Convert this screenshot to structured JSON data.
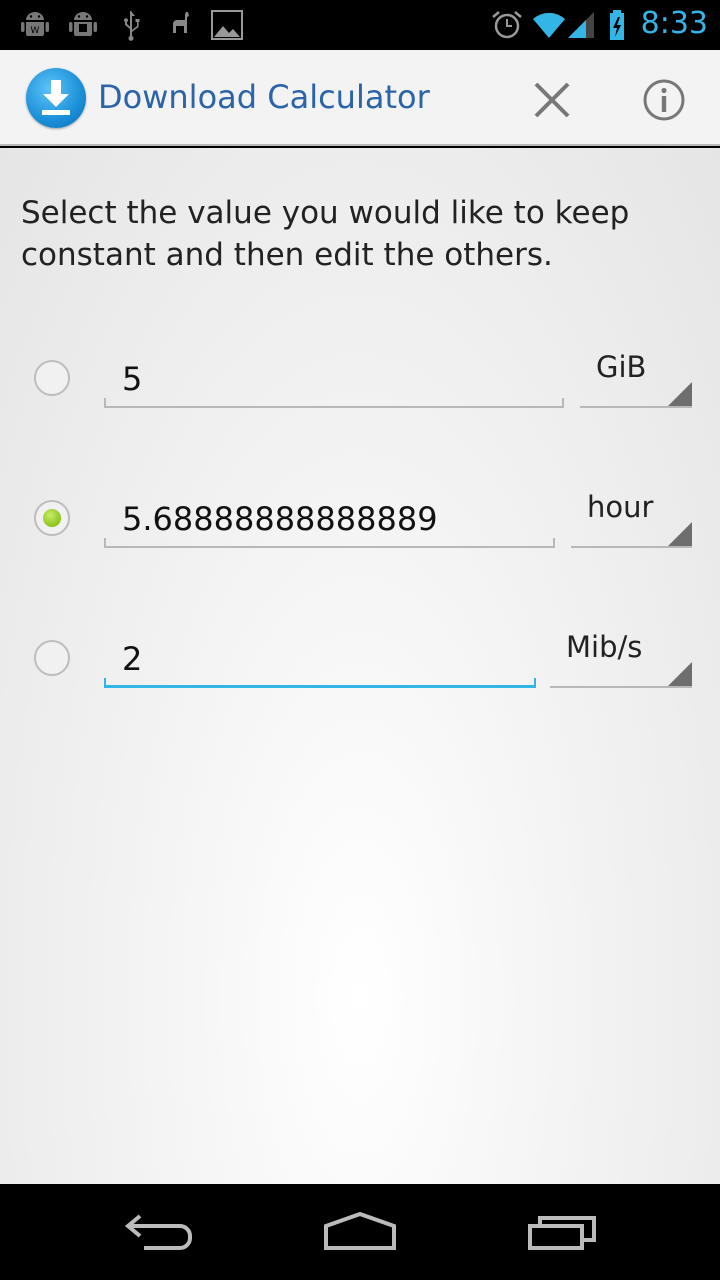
{
  "status_bar": {
    "time": "8:33",
    "left_icons": [
      "android-icon",
      "android-debug-icon",
      "usb-icon",
      "llama-icon",
      "image-icon"
    ],
    "right_icons": [
      "alarm-icon",
      "wifi-icon",
      "signal-icon",
      "battery-icon"
    ],
    "accent_color": "#33b5e5"
  },
  "action_bar": {
    "title": "Download Calculator",
    "app_icon": "download-icon",
    "close_icon": "close-icon",
    "info_icon": "info-icon"
  },
  "main": {
    "instructions": "Select the value you would like to keep constant and then edit the others.",
    "rows": [
      {
        "value": "5",
        "unit": "GiB",
        "selected": false,
        "focused": false
      },
      {
        "value": "5.68888888888889",
        "unit": "hour",
        "selected": true,
        "focused": false
      },
      {
        "value": "2",
        "unit": "Mib/s",
        "selected": false,
        "focused": true
      }
    ]
  },
  "nav_bar": {
    "back_icon": "back-icon",
    "home_icon": "home-icon",
    "recents_icon": "recent-apps-icon"
  }
}
